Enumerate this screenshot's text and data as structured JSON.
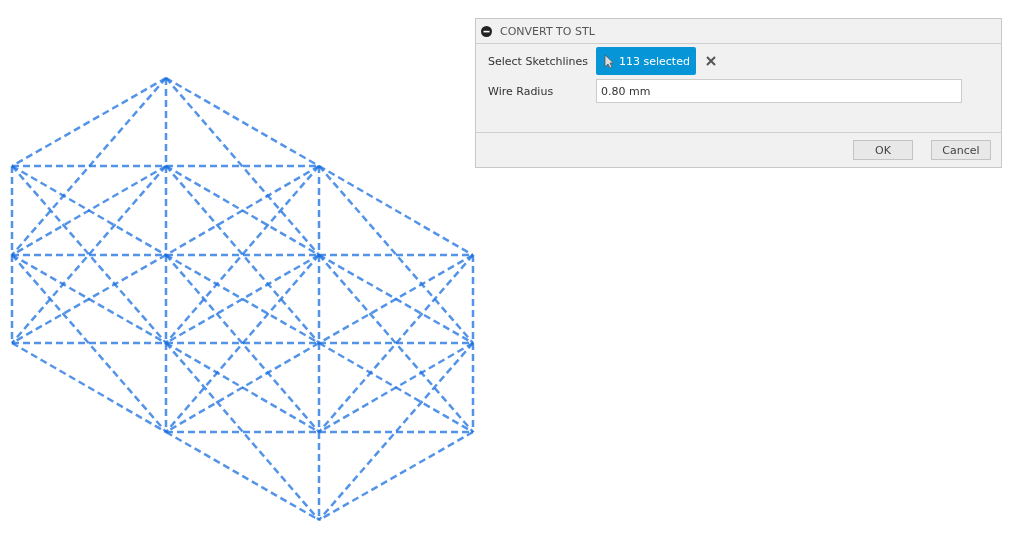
{
  "dialog": {
    "title": "CONVERT TO STL",
    "fields": [
      {
        "kind": "selection",
        "label": "Select Sketchlines",
        "value": "113 selected"
      },
      {
        "kind": "input",
        "label": "Wire Radius",
        "value": "0.80 mm"
      }
    ],
    "buttons": [
      "OK",
      "Cancel"
    ]
  }
}
